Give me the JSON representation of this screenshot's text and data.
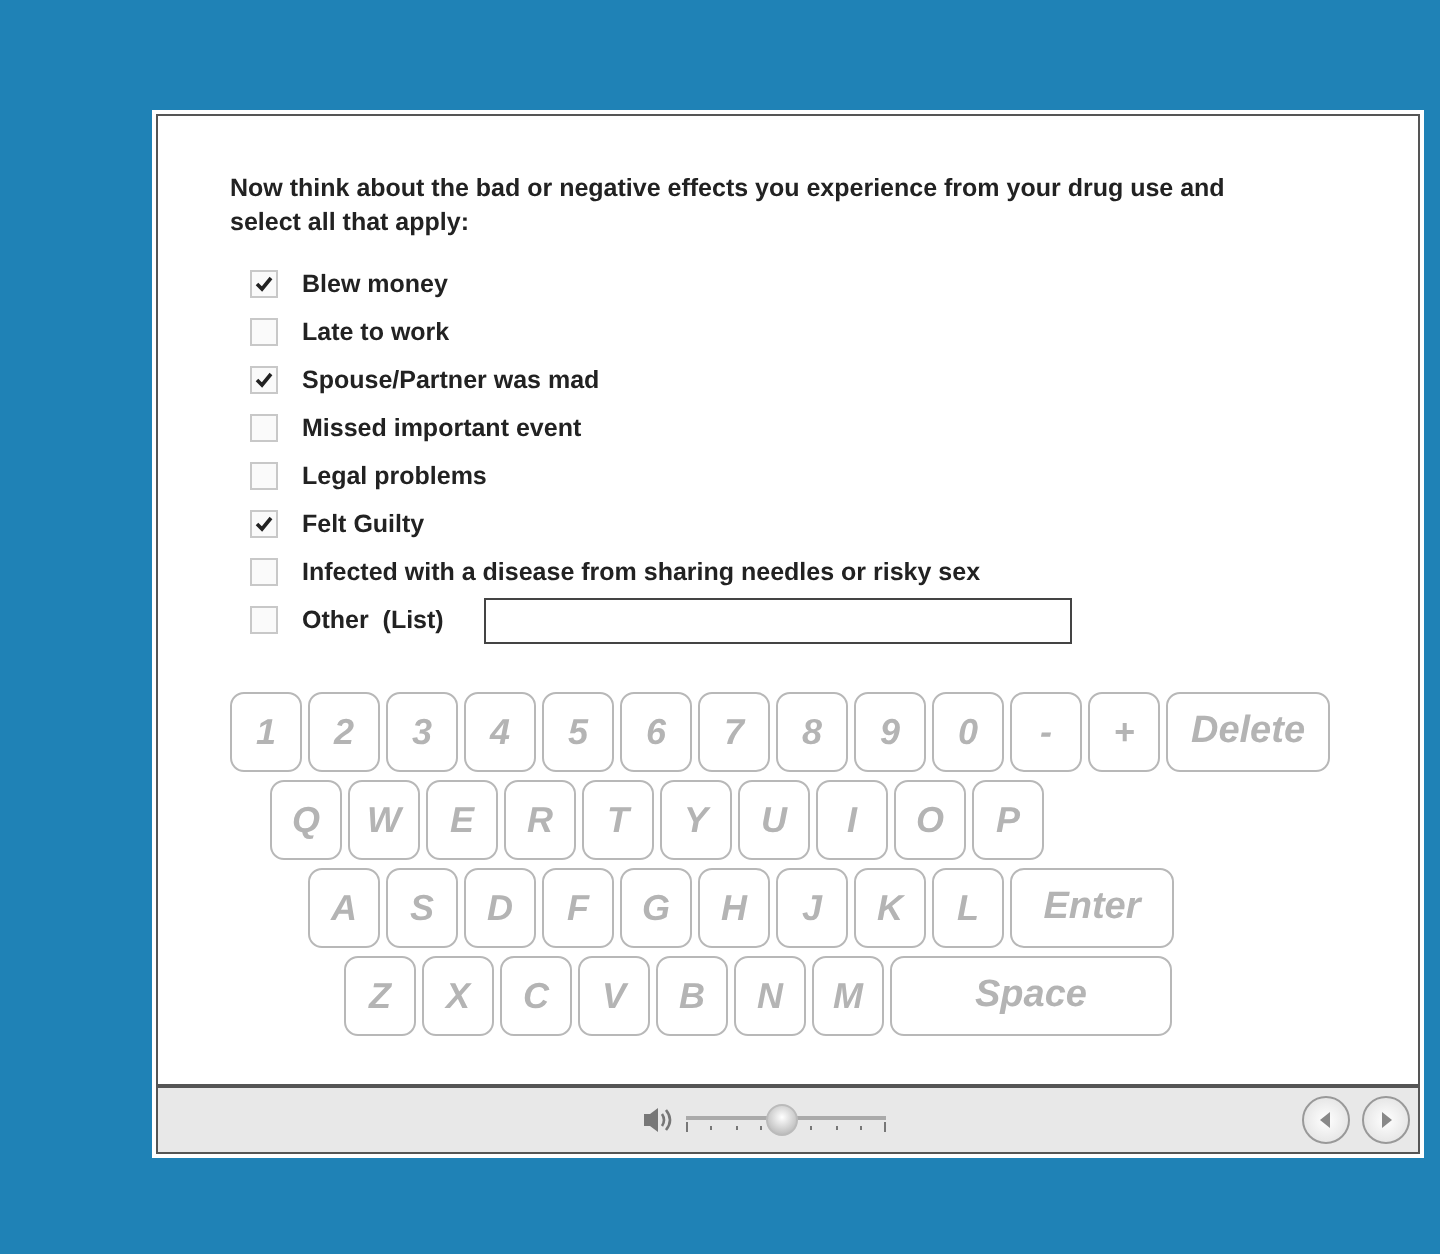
{
  "question": "Now think about the bad or negative effects you experience from your drug use and select all that apply:",
  "options": [
    {
      "label": "Blew money",
      "checked": true
    },
    {
      "label": "Late to work",
      "checked": false
    },
    {
      "label": "Spouse/Partner was mad",
      "checked": true
    },
    {
      "label": "Missed important event",
      "checked": false
    },
    {
      "label": "Legal problems",
      "checked": false
    },
    {
      "label": "Felt Guilty",
      "checked": true
    },
    {
      "label": "Infected with a disease from sharing needles or risky sex",
      "checked": false
    },
    {
      "label": "Other  (List)",
      "checked": false,
      "kind": "with-field"
    }
  ],
  "keyboard": [
    [
      {
        "label": "1"
      },
      {
        "label": "2"
      },
      {
        "label": "3"
      },
      {
        "label": "4"
      },
      {
        "label": "5"
      },
      {
        "label": "6"
      },
      {
        "label": "7"
      },
      {
        "label": "8"
      },
      {
        "label": "9"
      },
      {
        "label": "0"
      },
      {
        "label": "-"
      },
      {
        "label": "+"
      },
      {
        "label": "Delete",
        "kind": "wide"
      }
    ],
    [
      {
        "label": "Q"
      },
      {
        "label": "W"
      },
      {
        "label": "E"
      },
      {
        "label": "R"
      },
      {
        "label": "T"
      },
      {
        "label": "Y"
      },
      {
        "label": "U"
      },
      {
        "label": "I"
      },
      {
        "label": "O"
      },
      {
        "label": "P"
      }
    ],
    [
      {
        "label": "A"
      },
      {
        "label": "S"
      },
      {
        "label": "D"
      },
      {
        "label": "F"
      },
      {
        "label": "G"
      },
      {
        "label": "H"
      },
      {
        "label": "J"
      },
      {
        "label": "K"
      },
      {
        "label": "L"
      },
      {
        "label": "Enter",
        "kind": "wide"
      }
    ],
    [
      {
        "label": "Z"
      },
      {
        "label": "X"
      },
      {
        "label": "C"
      },
      {
        "label": "V"
      },
      {
        "label": "B"
      },
      {
        "label": "N"
      },
      {
        "label": "M"
      },
      {
        "label": "Space",
        "kind": "space"
      }
    ]
  ],
  "volume": {
    "level": 0.48
  }
}
